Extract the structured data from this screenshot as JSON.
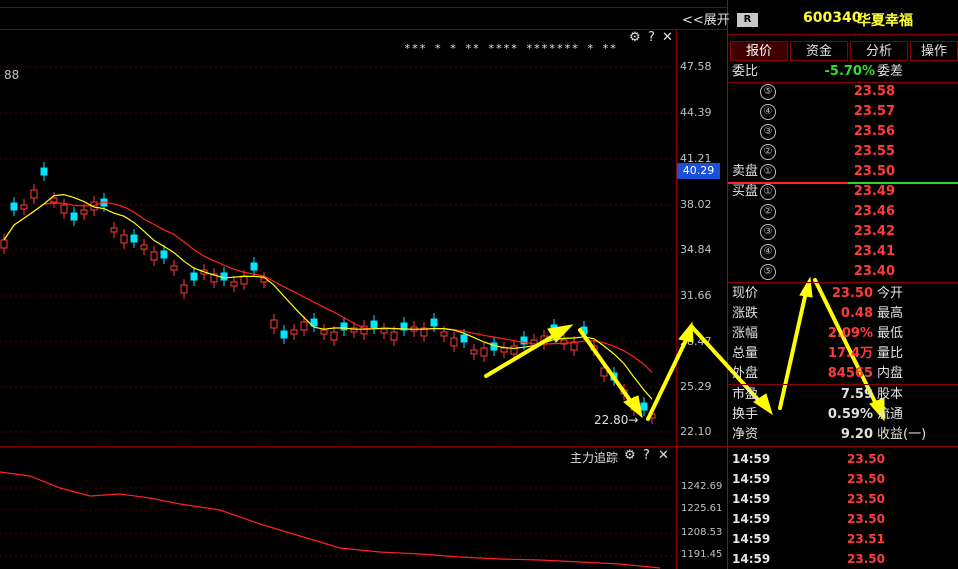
{
  "chart": {
    "expand_label": "<<展开",
    "corner_value": "88",
    "annotations": "*** * * ** **** ******* * **",
    "price_axis": [
      "47.58",
      "44.39",
      "41.21",
      "38.02",
      "34.84",
      "31.66",
      "28.47",
      "25.29",
      "22.10"
    ],
    "current_price_badge": "40.29",
    "low_label": "22.80",
    "low_arrow": "→",
    "controls": {
      "gear": "⚙",
      "help": "?",
      "close": "✕"
    }
  },
  "indicator": {
    "title": "主力追踪",
    "axis": [
      "1242.69",
      "1225.61",
      "1208.53",
      "1191.45"
    ],
    "controls": {
      "gear": "⚙",
      "help": "?",
      "close": "✕"
    }
  },
  "stock": {
    "badge": "R",
    "code": "600340",
    "name": "华夏幸福"
  },
  "tabs": [
    "报价",
    "资金",
    "分析",
    "操作"
  ],
  "weibi": {
    "label": "委比",
    "value": "-5.70%",
    "label2": "委差"
  },
  "sell_label": "卖盘",
  "buy_label": "买盘",
  "asks": [
    {
      "n": "⑤",
      "price": "23.58"
    },
    {
      "n": "④",
      "price": "23.57"
    },
    {
      "n": "③",
      "price": "23.56"
    },
    {
      "n": "②",
      "price": "23.55"
    },
    {
      "n": "①",
      "price": "23.50"
    }
  ],
  "bids": [
    {
      "n": "①",
      "price": "23.49"
    },
    {
      "n": "②",
      "price": "23.46"
    },
    {
      "n": "③",
      "price": "23.42"
    },
    {
      "n": "④",
      "price": "23.41"
    },
    {
      "n": "⑤",
      "price": "23.40"
    }
  ],
  "quote": [
    {
      "label": "现价",
      "value": "23.50",
      "label2": "今开"
    },
    {
      "label": "涨跌",
      "value": "0.48",
      "label2": "最高"
    },
    {
      "label": "涨幅",
      "value": "2.09%",
      "label2": "最低"
    },
    {
      "label": "总量",
      "value": "17.4万",
      "label2": "量比"
    },
    {
      "label": "外盘",
      "value": "84565",
      "label2": "内盘"
    }
  ],
  "quote2": [
    {
      "label": "市盈",
      "value": "7.59",
      "label2": "股本"
    },
    {
      "label": "换手",
      "value": "0.59%",
      "label2": "流通"
    },
    {
      "label": "净资",
      "value": "9.20",
      "label2": "收益(一)"
    }
  ],
  "ticks": [
    {
      "time": "14:59",
      "price": "23.50"
    },
    {
      "time": "14:59",
      "price": "23.50"
    },
    {
      "time": "14:59",
      "price": "23.50"
    },
    {
      "time": "14:59",
      "price": "23.50"
    },
    {
      "time": "14:59",
      "price": "23.51"
    },
    {
      "time": "14:59",
      "price": "23.50"
    }
  ],
  "colors": {
    "up": "#ff3b3b",
    "down": "#00e5ff",
    "ma5": "#ffff00",
    "ma10": "#ff2222",
    "frame": "#8a0000",
    "arrow": "#ffff00"
  }
}
